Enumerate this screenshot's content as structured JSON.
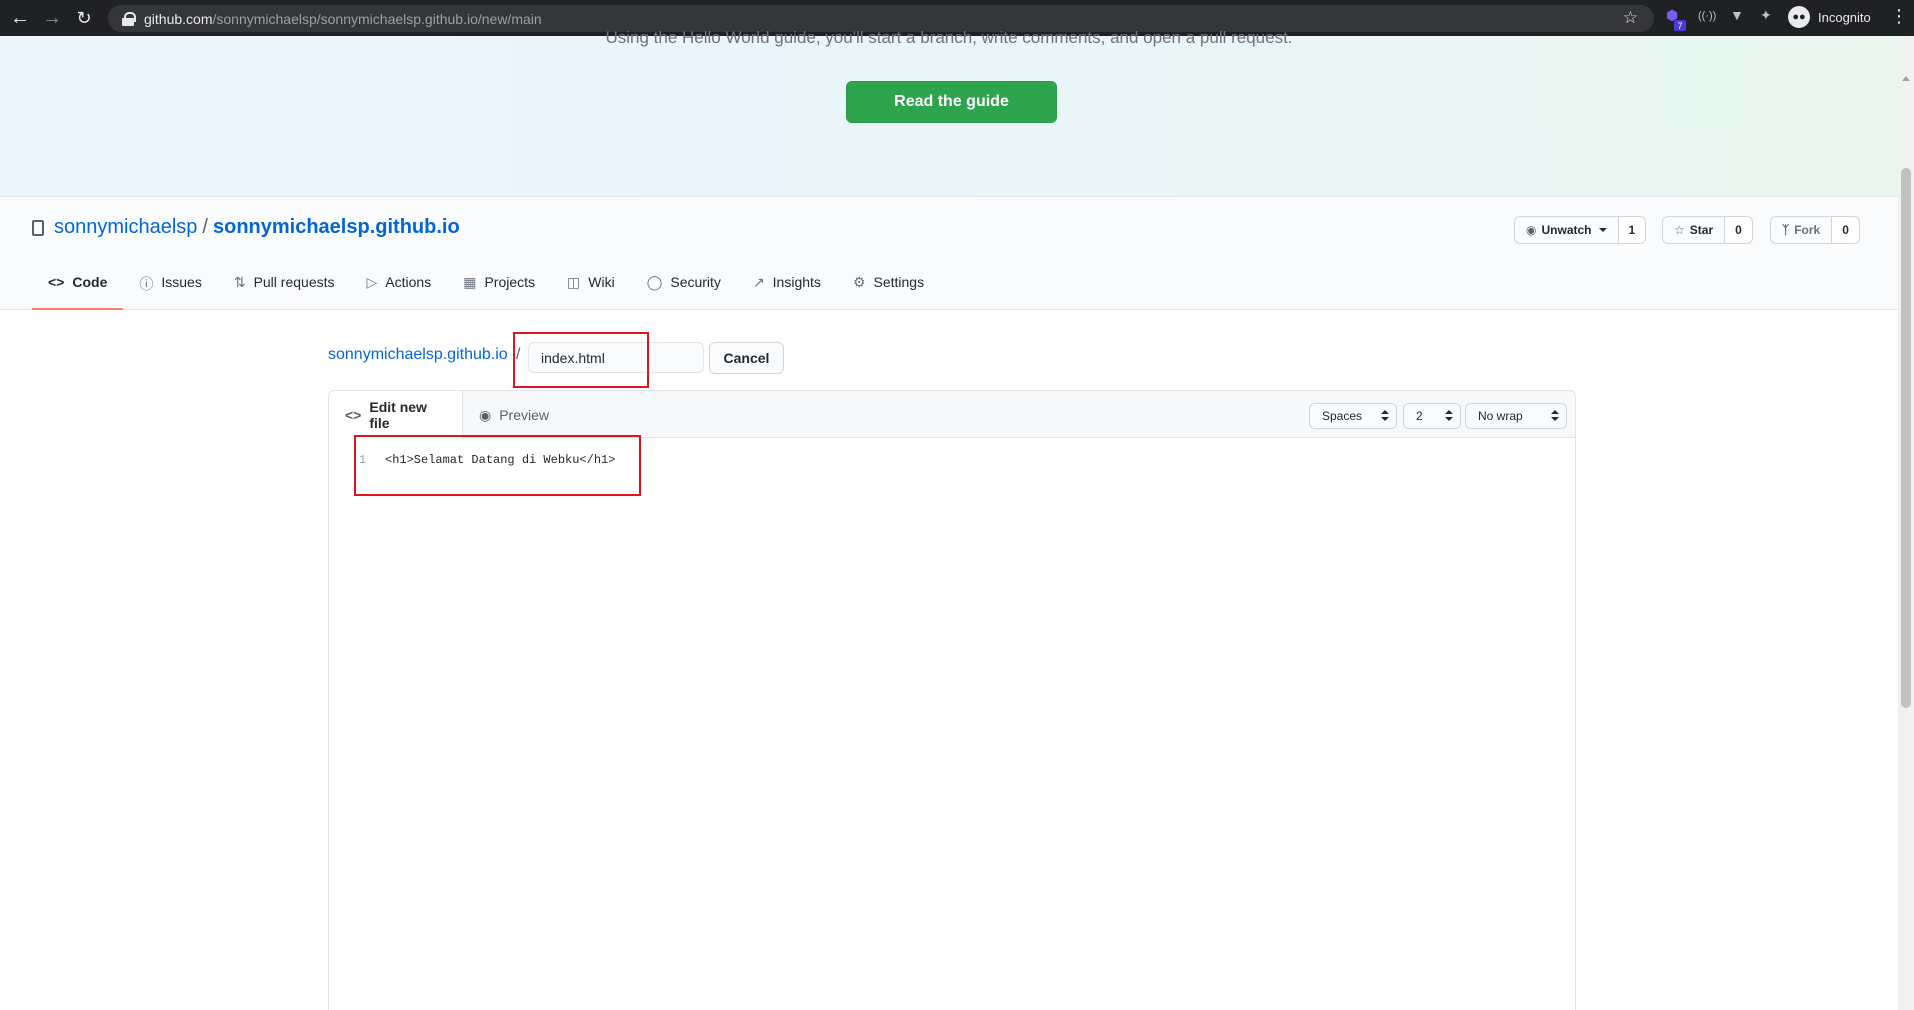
{
  "browser": {
    "url_host": "github.com",
    "url_path": "/sonnymichaelsp/sonnymichaelsp.github.io/new/main",
    "extension_badge": "7",
    "profile_label": "Incognito"
  },
  "hero": {
    "text": "Using the Hello World guide, you'll start a branch, write comments, and open a pull request.",
    "button_label": "Read the guide"
  },
  "repo": {
    "owner": "sonnymichaelsp",
    "separator": "/",
    "name": "sonnymichaelsp.github.io",
    "unwatch_label": "Unwatch",
    "watch_count": "1",
    "star_label": "Star",
    "star_count": "0",
    "fork_label": "Fork",
    "fork_count": "0"
  },
  "tabs": [
    {
      "label": "Code",
      "icon": "code-icon"
    },
    {
      "label": "Issues",
      "icon": "issue-icon"
    },
    {
      "label": "Pull requests",
      "icon": "pull-request-icon"
    },
    {
      "label": "Actions",
      "icon": "play-icon"
    },
    {
      "label": "Projects",
      "icon": "project-icon"
    },
    {
      "label": "Wiki",
      "icon": "book-icon"
    },
    {
      "label": "Security",
      "icon": "shield-icon"
    },
    {
      "label": "Insights",
      "icon": "graph-icon"
    },
    {
      "label": "Settings",
      "icon": "gear-icon"
    }
  ],
  "file": {
    "breadcrumb": "sonnymichaelsp.github.io",
    "separator": "/",
    "name_value": "index.html",
    "cancel_label": "Cancel"
  },
  "editor": {
    "edit_tab_label": "Edit new file",
    "preview_tab_label": "Preview",
    "indent_mode": "Spaces",
    "indent_size": "2",
    "wrap_mode": "No wrap",
    "lines": [
      {
        "number": "1",
        "text": "<h1>Selamat Datang di Webku</h1>"
      }
    ]
  },
  "colors": {
    "accent_green": "#2ea44f",
    "link_blue": "#0366d6",
    "active_tab_underline": "#f9826c",
    "highlight_red": "#e0141e"
  }
}
